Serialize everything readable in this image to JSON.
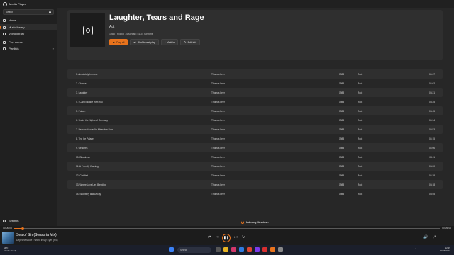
{
  "window": {
    "title": "Media Player"
  },
  "sidebar": {
    "search_placeholder": "Search",
    "items": [
      {
        "label": "Home",
        "icon": "home-icon"
      },
      {
        "label": "Music library",
        "icon": "music-icon"
      },
      {
        "label": "Video library",
        "icon": "video-icon"
      },
      {
        "label": "Play queue",
        "icon": "queue-icon"
      },
      {
        "label": "Playlists",
        "icon": "playlist-icon"
      }
    ],
    "settings_label": "Settings"
  },
  "album": {
    "title": "Laughter, Tears and Rage",
    "artist": "Act",
    "meta": "1988 • Rock • 14 songs • 51:24 run time",
    "buttons": {
      "play_all": "Play all",
      "shuffle": "Shuffle and play",
      "add_to": "Add to",
      "edit_info": "Edit info"
    }
  },
  "tracks": [
    {
      "num": "1.",
      "title": "Absolutely Immune",
      "artist": "Thomas Leer",
      "year": "1988",
      "genre": "Rock",
      "duration": "04:07"
    },
    {
      "num": "2.",
      "title": "Chance",
      "artist": "Thomas Leer",
      "year": "1988",
      "genre": "Rock",
      "duration": "04:02"
    },
    {
      "num": "3.",
      "title": "Laughter",
      "artist": "Thomas Leer",
      "year": "1988",
      "genre": "Rock",
      "duration": "03:21"
    },
    {
      "num": "4.",
      "title": "I Can't Escape from You",
      "artist": "Thomas Leer",
      "year": "1988",
      "genre": "Rock",
      "duration": "03:25"
    },
    {
      "num": "5.",
      "title": "Poison",
      "artist": "Thomas Leer",
      "year": "1988",
      "genre": "Rock",
      "duration": "03:45"
    },
    {
      "num": "6.",
      "title": "Under the Nights of Germany",
      "artist": "Thomas Leer",
      "year": "1988",
      "genre": "Rock",
      "duration": "04:34"
    },
    {
      "num": "7.",
      "title": "Heaven Knows I'm Miserable Now",
      "artist": "Thomas Leer",
      "year": "1988",
      "genre": "Rock",
      "duration": "03:53"
    },
    {
      "num": "8.",
      "title": "The Ice Palace",
      "artist": "Thomas Leer",
      "year": "1988",
      "genre": "Rock",
      "duration": "04:15"
    },
    {
      "num": "9.",
      "title": "Gestures",
      "artist": "Thomas Leer",
      "year": "1988",
      "genre": "Rock",
      "duration": "04:06"
    },
    {
      "num": "10.",
      "title": "Bloodrush",
      "artist": "Thomas Leer",
      "year": "1988",
      "genre": "Rock",
      "duration": "04:11"
    },
    {
      "num": "11.",
      "title": "A Friendly Warning",
      "artist": "Thomas Leer",
      "year": "1988",
      "genre": "Rock",
      "duration": "03:20"
    },
    {
      "num": "12.",
      "title": "Certified",
      "artist": "Thomas Leer",
      "year": "1988",
      "genre": "Rock",
      "duration": "04:28"
    },
    {
      "num": "13.",
      "title": "Where Love Lies Bleeding",
      "artist": "Thomas Leer",
      "year": "1988",
      "genre": "Rock",
      "duration": "03:18"
    },
    {
      "num": "14.",
      "title": "Snobbery and Decay",
      "artist": "Thomas Leer",
      "year": "1988",
      "genre": "Rock",
      "duration": "03:55"
    }
  ],
  "indexing_text": "Indexing libraries...",
  "player": {
    "elapsed": "00:00:06",
    "total": "00:06:06",
    "progress_fraction": 0.02,
    "now_title": "Sea of Sin (Sensoria Mix)",
    "now_sub": "Depeche Mode • World in My Eyes (PS)",
    "accent": "#e8731c"
  },
  "taskbar": {
    "weather_temp": "54°F",
    "weather_desc": "Mostly cloudy",
    "search_label": "Search",
    "time": "12:15",
    "date": "10/26/2023"
  }
}
